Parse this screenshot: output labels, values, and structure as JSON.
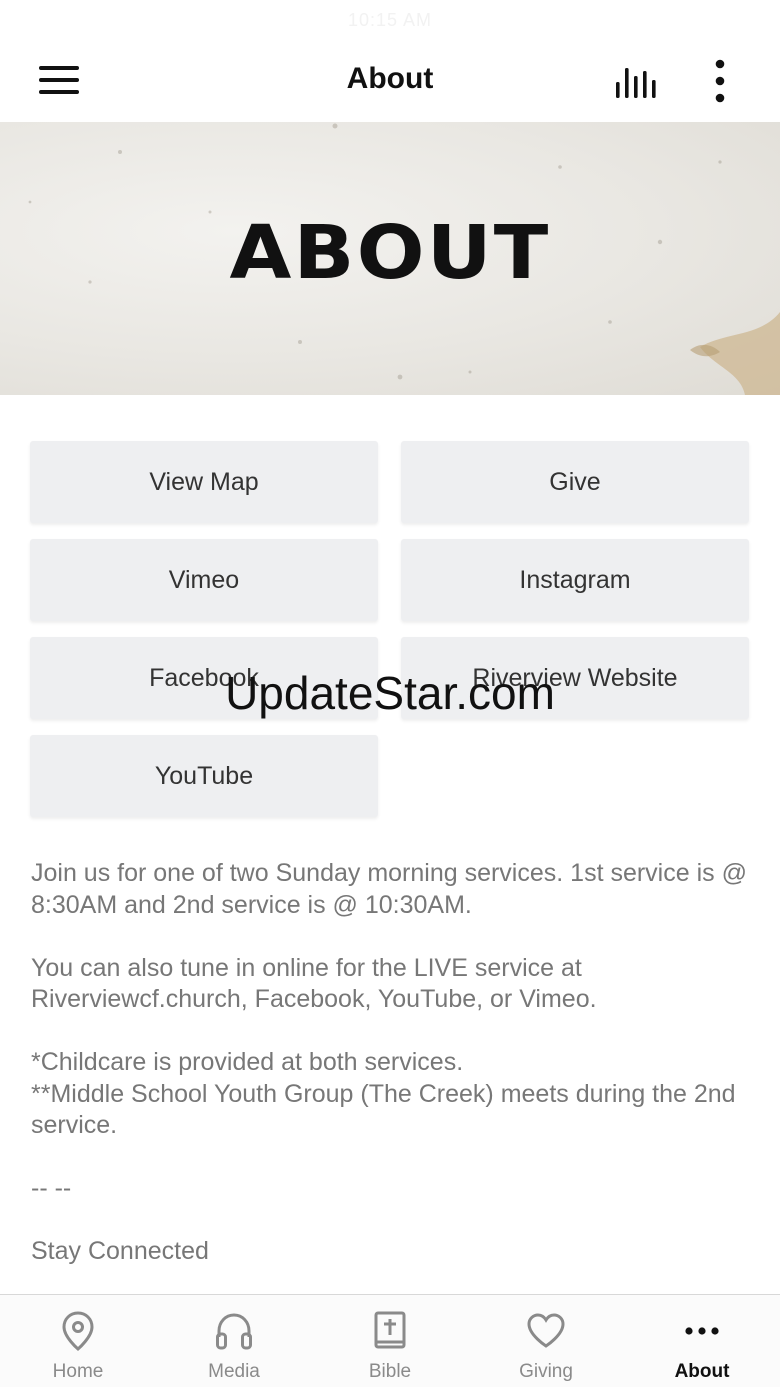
{
  "status_bar": {
    "time": "10:15 AM"
  },
  "nav": {
    "title": "About"
  },
  "hero": {
    "title": "ABOUT"
  },
  "buttons": [
    "View Map",
    "Give",
    "Vimeo",
    "Instagram",
    "Facebook",
    "Riverview Website",
    "YouTube"
  ],
  "body": {
    "p1": "Join us for one of two Sunday morning services.  1st service is @ 8:30AM and 2nd service is @ 10:30AM.",
    "p2": "You can also tune in online for the LIVE service at Riverviewcf.church, Facebook, YouTube, or Vimeo.",
    "p3a": "*Childcare is provided at both services.",
    "p3b": "**Middle School Youth Group (The Creek) meets during the 2nd service.",
    "divider": "-- --",
    "p4": "Stay Connected"
  },
  "watermark": "UpdateStar.com",
  "tabs": [
    {
      "label": "Home",
      "icon": "location-pin-icon"
    },
    {
      "label": "Media",
      "icon": "headphones-icon"
    },
    {
      "label": "Bible",
      "icon": "bible-icon"
    },
    {
      "label": "Giving",
      "icon": "heart-icon"
    },
    {
      "label": "About",
      "icon": "more-dots-icon"
    }
  ],
  "colors": {
    "active_tab": "#111111",
    "inactive_tab": "#8a8a8a",
    "button_bg": "#eeeff1",
    "body_text": "#777777"
  }
}
